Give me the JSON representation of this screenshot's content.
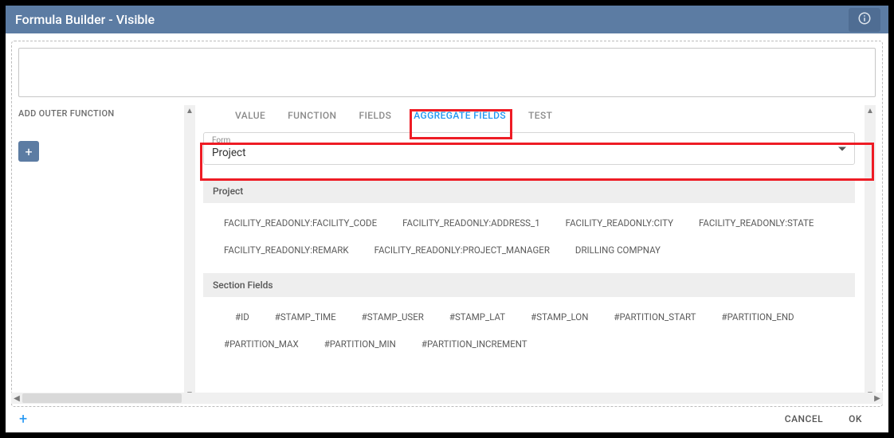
{
  "titlebar": {
    "title": "Formula Builder - Visible"
  },
  "formula": {
    "value": ""
  },
  "leftPane": {
    "label": "ADD OUTER FUNCTION",
    "addIcon": "+"
  },
  "tabs": {
    "value": "VALUE",
    "function": "FUNCTION",
    "fields": "FIELDS",
    "aggregate": "AGGREGATE FIELDS",
    "test": "TEST"
  },
  "formSelect": {
    "label": "Form",
    "value": "Project"
  },
  "groups": {
    "g1": {
      "header": "Project",
      "items": {
        "i0": "FACILITY_READONLY:FACILITY_CODE",
        "i1": "FACILITY_READONLY:ADDRESS_1",
        "i2": "FACILITY_READONLY:CITY",
        "i3": "FACILITY_READONLY:STATE",
        "i4": "FACILITY_READONLY:REMARK",
        "i5": "FACILITY_READONLY:PROJECT_MANAGER",
        "i6": "DRILLING COMPNAY"
      }
    },
    "g2": {
      "header": "Section Fields",
      "items": {
        "i0": "#ID",
        "i1": "#STAMP_TIME",
        "i2": "#STAMP_USER",
        "i3": "#STAMP_LAT",
        "i4": "#STAMP_LON",
        "i5": "#PARTITION_START",
        "i6": "#PARTITION_END",
        "i7": "#PARTITION_MAX",
        "i8": "#PARTITION_MIN",
        "i9": "#PARTITION_INCREMENT"
      }
    }
  },
  "footer": {
    "cancel": "CANCEL",
    "ok": "OK",
    "plus": "+"
  }
}
